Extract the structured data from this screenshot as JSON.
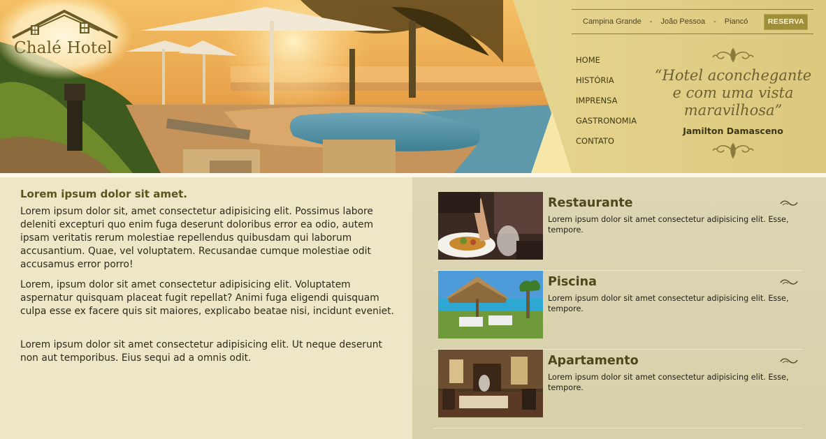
{
  "brand": {
    "name": "Chalé Hotel"
  },
  "top_nav": {
    "cities": [
      "Campina Grande",
      "João Pessoa",
      "Piancó"
    ],
    "separator": "-",
    "reserve_label": "RESERVA"
  },
  "main_nav": {
    "items": [
      "HOME",
      "HISTÓRIA",
      "IMPRENSA",
      "GASTRONOMIA",
      "CONTATO"
    ]
  },
  "quote": {
    "lines": [
      "“Hotel aconchegante",
      "e com uma vista",
      "maravilhosa”"
    ],
    "author": "Jamilton Damasceno"
  },
  "intro": {
    "title": "Lorem ipsum dolor sit amet.",
    "paragraphs": [
      "Lorem ipsum dolor sit, amet consectetur adipisicing elit. Possimus labore deleniti excepturi quo enim fuga deserunt doloribus error ea odio, autem ipsam veritatis rerum molestiae repellendus quibusdam qui laborum accusantium. Quae, vel voluptatem. Recusandae cumque molestiae odit accusamus error porro!",
      "Lorem, ipsum dolor sit amet consectetur adipisicing elit. Voluptatem aspernatur quisquam placeat fugit repellat? Animi fuga eligendi quisquam culpa esse ex facere quis sit maiores, explicabo beatae nisi, incidunt eveniet.",
      "Lorem ipsum dolor sit amet consectetur adipisicing elit. Ut neque deserunt non aut temporibus. Eius sequi ad a omnis odit."
    ]
  },
  "features": [
    {
      "title": "Restaurante",
      "text": "Lorem ipsum dolor sit amet consectetur adipisicing elit. Esse, tempore."
    },
    {
      "title": "Piscina",
      "text": "Lorem ipsum dolor sit amet consectetur adipisicing elit. Esse, tempore."
    },
    {
      "title": "Apartamento",
      "text": "Lorem ipsum dolor sit amet consectetur adipisicing elit. Esse, tempore."
    }
  ],
  "colors": {
    "header_panel": "#e1cf86",
    "reserve_button": "#9e8f3b",
    "content_left": "#ede7c8",
    "content_right": "#d8d0a8",
    "heading": "#5e531c"
  }
}
